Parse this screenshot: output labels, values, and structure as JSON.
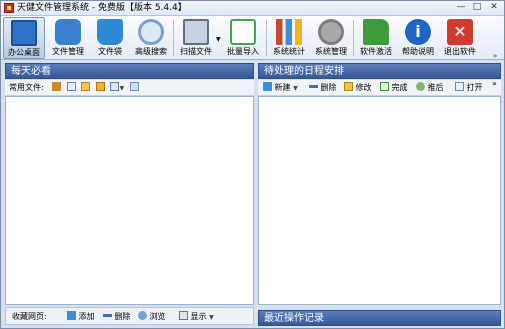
{
  "window": {
    "title": "天健文件管理系统 - 免费版【版本 5.4.4】",
    "minimize": "—",
    "maximize": "□",
    "close": "✕"
  },
  "toolbar": {
    "items": [
      {
        "label": "办公桌面",
        "icon": "desktop-icon",
        "color": "#2f73c7"
      },
      {
        "label": "文件管理",
        "icon": "folder-gear-icon",
        "color": "#3a7fd0"
      },
      {
        "label": "文件袋",
        "icon": "file-bag-icon",
        "color": "#2e8ad6"
      },
      {
        "label": "高级搜索",
        "icon": "magnifier-icon",
        "color": "#7aa1cc"
      },
      {
        "label": "扫描文件",
        "icon": "scanner-icon",
        "color": "#5b6f88"
      },
      {
        "label": "批量导入",
        "icon": "batch-import-icon",
        "color": "#3ea84a"
      },
      {
        "label": "系统统计",
        "icon": "bar-chart-icon",
        "color": "#c8482f"
      },
      {
        "label": "系统管理",
        "icon": "gear-icon",
        "color": "#7d7d7d"
      },
      {
        "label": "软件激活",
        "icon": "key-folder-icon",
        "color": "#3c9c3c"
      },
      {
        "label": "帮助说明",
        "icon": "info-icon",
        "color": "#1f65c6"
      },
      {
        "label": "退出软件",
        "icon": "exit-icon",
        "color": "#d33a2f"
      }
    ],
    "overflow": "»"
  },
  "left_top": {
    "title": "每天必看",
    "subbar_label": "常用文件:"
  },
  "right_top": {
    "title": "待处理的日程安排",
    "new_label": "新建",
    "delete_label": "删除",
    "edit_label": "修改",
    "done_label": "完成",
    "postpone_label": "推后",
    "open_label": "打开",
    "overflow": "»"
  },
  "left_bottom": {
    "label": "收藏网页:",
    "add_label": "添加",
    "delete_label": "删除",
    "browse_label": "浏览",
    "display_label": "显示"
  },
  "right_bottom": {
    "title": "最近操作记录"
  }
}
